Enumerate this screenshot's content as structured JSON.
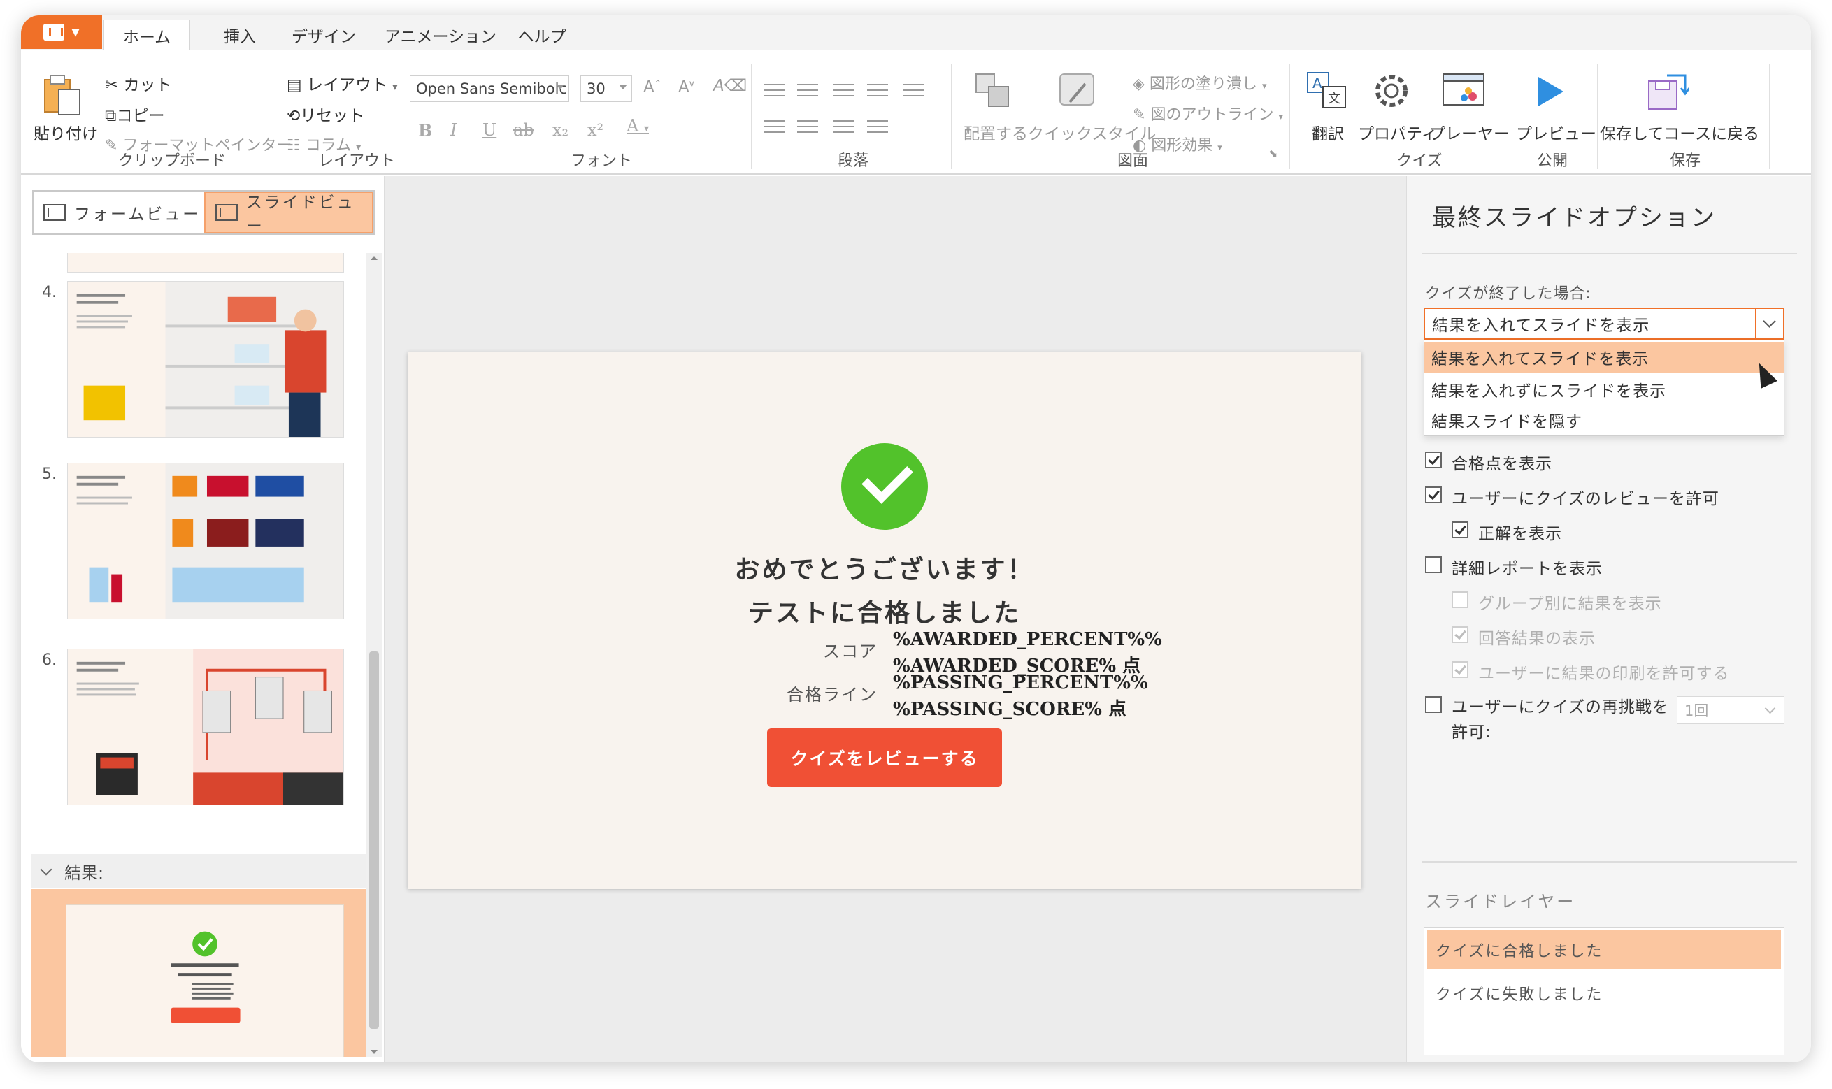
{
  "tabs": {
    "home": "ホーム",
    "insert": "挿入",
    "design": "デザイン",
    "animation": "アニメーション",
    "help": "ヘルプ"
  },
  "ribbon": {
    "clipboard": {
      "paste": "貼り付け",
      "cut": "カット",
      "copy": "コピー",
      "format_painter": "フォーマットペインター",
      "group": "クリップボード"
    },
    "layout": {
      "layout": "レイアウト",
      "reset": "リセット",
      "columns": "コラム",
      "group": "レイアウト"
    },
    "font": {
      "family": "Open Sans Semibolc",
      "size": "30",
      "group": "フォント"
    },
    "paragraph": {
      "group": "段落"
    },
    "drawing": {
      "arrange": "配置する",
      "quick_style": "クイックスタイル",
      "shape_fill": "図形の塗り潰し",
      "shape_outline": "図のアウトライン",
      "shape_effects": "図形効果",
      "group": "図面"
    },
    "quiz": {
      "translate": "翻訳",
      "properties": "プロパティ",
      "player": "プレーヤー",
      "group": "クイズ"
    },
    "publish": {
      "preview": "プレビュー",
      "group": "公開"
    },
    "save": {
      "save_return": "保存してコースに戻る",
      "group": "保存"
    }
  },
  "left": {
    "form_view": "フォームビュー",
    "slide_view": "スライドビュー",
    "slides": [
      {
        "num": "4."
      },
      {
        "num": "5."
      },
      {
        "num": "6."
      }
    ],
    "results_header": "結果:"
  },
  "slide": {
    "line1": "おめでとうございます！",
    "line2": "テストに合格しました",
    "score_label": "スコア",
    "score_val1": "%AWARDED_PERCENT%%",
    "score_val2": "%AWARDED_SCORE% 点",
    "pass_label": "合格ライン",
    "pass_val1": "%PASSING_PERCENT%%",
    "pass_val2": "%PASSING_SCORE% 点",
    "review_button": "クイズをレビューする"
  },
  "right": {
    "title": "最終スライドオプション",
    "when_finished": "クイズが終了した場合:",
    "select_value": "結果を入れてスライドを表示",
    "options": [
      "結果を入れてスライドを表示",
      "結果を入れずにスライドを表示",
      "結果スライドを隠す"
    ],
    "checks": {
      "show_passing": "合格点を表示",
      "allow_review": "ユーザーにクイズのレビューを許可",
      "show_correct": "正解を表示",
      "detailed_report": "詳細レポートを表示",
      "group_results": "グループ別に結果を表示",
      "show_answers": "回答結果の表示",
      "allow_print": "ユーザーに結果の印刷を許可する",
      "allow_retry": "ユーザーにクイズの再挑戦を許可:"
    },
    "retry_count": "1回",
    "layers_title": "スライドレイヤー",
    "layers": [
      "クイズに合格しました",
      "クイズに失敗しました"
    ]
  },
  "colors": {
    "accent": "#f07028",
    "selection": "#fbc6a0",
    "check_green": "#52c22b",
    "review_button": "#f05035",
    "preview_blue": "#2f8fe0"
  }
}
